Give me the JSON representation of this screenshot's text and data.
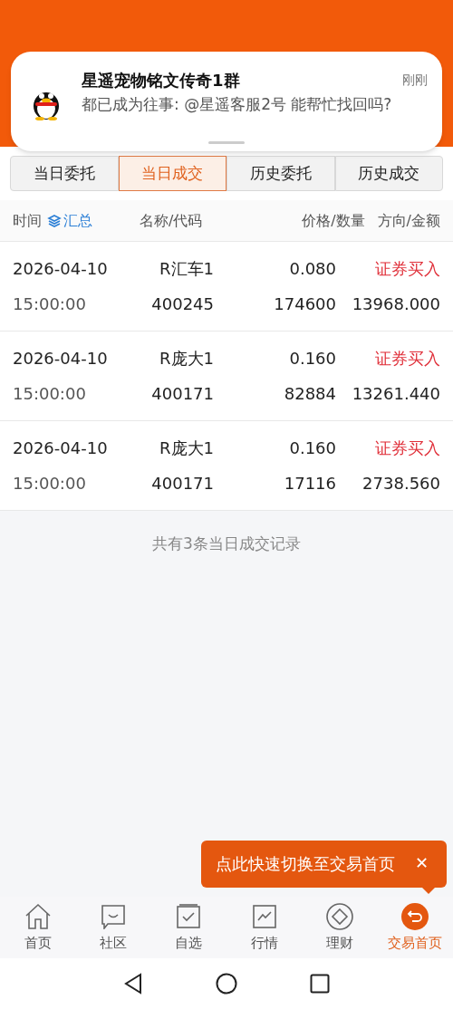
{
  "notification": {
    "title": "星遥宠物铭文传奇1群",
    "time": "刚刚",
    "message": "都已成为往事: @星遥客服2号 能帮忙找回吗?"
  },
  "tabs": [
    {
      "label": "当日委托",
      "selected": false
    },
    {
      "label": "当日成交",
      "selected": true
    },
    {
      "label": "历史委托",
      "selected": false
    },
    {
      "label": "历史成交",
      "selected": false
    }
  ],
  "columns": {
    "time": "时间",
    "summary": "汇总",
    "name_code": "名称/代码",
    "price_qty": "价格/数量",
    "dir_amount": "方向/金额"
  },
  "rows": [
    {
      "date": "2026-04-10",
      "time": "15:00:00",
      "name": "R汇车1",
      "code": "400245",
      "price": "0.080",
      "quantity": "174600",
      "direction": "证券买入",
      "amount": "13968.000"
    },
    {
      "date": "2026-04-10",
      "time": "15:00:00",
      "name": "R庞大1",
      "code": "400171",
      "price": "0.160",
      "quantity": "82884",
      "direction": "证券买入",
      "amount": "13261.440"
    },
    {
      "date": "2026-04-10",
      "time": "15:00:00",
      "name": "R庞大1",
      "code": "400171",
      "price": "0.160",
      "quantity": "17116",
      "direction": "证券买入",
      "amount": "2738.560"
    }
  ],
  "footer": "共有3条当日成交记录",
  "tooltip": {
    "text": "点此快速切换至交易首页",
    "close": "✕"
  },
  "nav": [
    {
      "label": "首页",
      "kind": "home",
      "selected": false
    },
    {
      "label": "社区",
      "kind": "chat",
      "selected": false
    },
    {
      "label": "自选",
      "kind": "check",
      "selected": false
    },
    {
      "label": "行情",
      "kind": "chart",
      "selected": false
    },
    {
      "label": "理财",
      "kind": "diamond",
      "selected": false
    },
    {
      "label": "交易首页",
      "kind": "back",
      "selected": true
    }
  ]
}
